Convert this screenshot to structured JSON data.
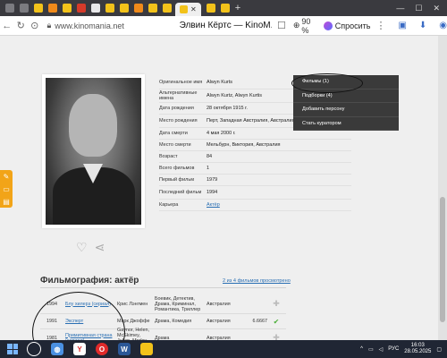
{
  "browser": {
    "url": "www.kinomania.net",
    "page_title": "Элвин Кёртс — KinoM...",
    "zoom": "90 %",
    "ask_label": "Спросить"
  },
  "person_info": {
    "rows": [
      {
        "label": "Оригинальное имя",
        "value": "Alwyn Kurts"
      },
      {
        "label": "Альтернативные имена",
        "value": "Alwyn Kurtz, Alwyn Kurtis"
      },
      {
        "label": "Дата рождения",
        "value": "28 октября 1915 г."
      },
      {
        "label": "Место рождения",
        "value": "Перт, Западная Австралия, Австралия"
      },
      {
        "label": "Дата смерти",
        "value": "4 мая 2000 г."
      },
      {
        "label": "Место смерти",
        "value": "Мельбурн, Виктория, Австралия"
      },
      {
        "label": "Возраст",
        "value": "84"
      },
      {
        "label": "Всего фильмов",
        "value": "1"
      },
      {
        "label": "Первый фильм",
        "value": "1979"
      },
      {
        "label": "Последний фильм",
        "value": "1994"
      },
      {
        "label": "Карьера",
        "value": "Актёр"
      }
    ]
  },
  "menu": {
    "items": [
      {
        "label": "Фильмы (1)"
      },
      {
        "label": "Подборки (4)"
      },
      {
        "label": "Добавить персону"
      },
      {
        "label": "Стать куратором"
      }
    ]
  },
  "filmography": {
    "title": "Фильмография: актёр",
    "link": "2 из 4 фильмов просмотрено",
    "films": [
      {
        "year": "1994",
        "title": "Блу хилерз (сериал)",
        "director": "Крис Лэнгмен",
        "genre": "Боевик, Детектив, Драма, Криминал, Романтика, Триллер",
        "country": "Австралия",
        "rating": "",
        "mark": "plus"
      },
      {
        "year": "1991",
        "title": "Эксперт",
        "director": "Марк Джоффе",
        "genre": "Драма, Комедия",
        "country": "Австралия",
        "rating": "6.6667",
        "mark": "check"
      },
      {
        "year": "1981",
        "title": "Примитивная страна (сериал)",
        "director": "Gaynor, Helen, McSkimey, Julian, Morley, Julie",
        "genre": "Драма",
        "country": "Австралия",
        "rating": "",
        "mark": "plus"
      },
      {
        "year": "1979",
        "title": "Тим",
        "director": "Майкл Пэйт",
        "genre": "Драма, Мелодрама",
        "country": "Австралия",
        "rating": "6.0000",
        "mark": "check"
      }
    ]
  },
  "taskbar": {
    "lang": "РУС",
    "time": "16:03",
    "date": "28.05.2025"
  }
}
